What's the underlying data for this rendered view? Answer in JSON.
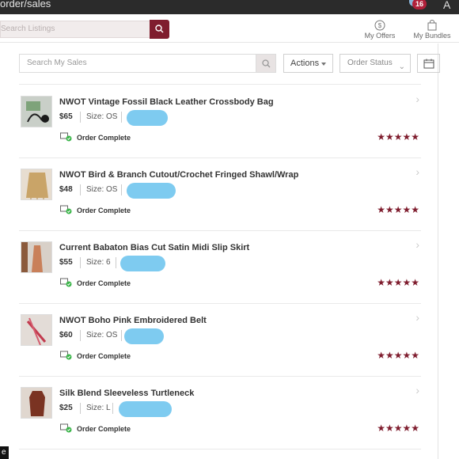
{
  "window": {
    "url_fragment": "order/sales",
    "notification_count": "16",
    "avatar_letter": "A"
  },
  "header": {
    "search_placeholder": "Search Listings",
    "my_offers": "My Offers",
    "my_bundles": "My Bundles"
  },
  "toolbar": {
    "search_placeholder": "Search My Sales",
    "actions_label": "Actions",
    "order_status_label": "Order Status"
  },
  "orders": [
    {
      "title": "NWOT Vintage Fossil Black Leather Crossbody Bag",
      "price": "$65",
      "size": "Size: OS",
      "status": "Order Complete",
      "rating": "★★★★★"
    },
    {
      "title": "NWOT Bird & Branch Cutout/Crochet Fringed Shawl/Wrap",
      "price": "$48",
      "size": "Size: OS",
      "status": "Order Complete",
      "rating": "★★★★★"
    },
    {
      "title": "Current Babaton Bias Cut Satin Midi Slip Skirt",
      "price": "$55",
      "size": "Size: 6",
      "status": "Order Complete",
      "rating": "★★★★★"
    },
    {
      "title": "NWOT Boho Pink Embroidered Belt",
      "price": "$60",
      "size": "Size: OS",
      "status": "Order Complete",
      "rating": "★★★★★"
    },
    {
      "title": "Silk Blend Sleeveless Turtleneck",
      "price": "$25",
      "size": "Size: L",
      "status": "Order Complete",
      "rating": "★★★★★"
    }
  ],
  "corner_label": "e",
  "colors": {
    "brand": "#7f1d2e",
    "topbar": "#2b2b2b",
    "redaction": "#7ecbf0"
  }
}
